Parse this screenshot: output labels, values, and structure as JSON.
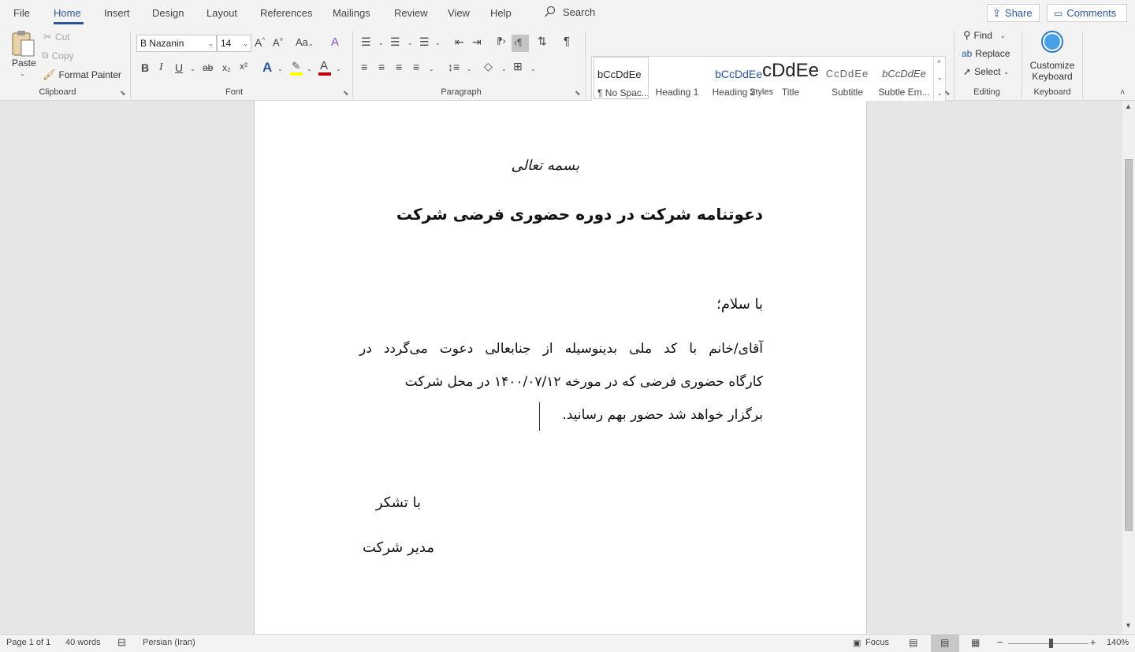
{
  "menu": {
    "tabs": [
      "File",
      "Home",
      "Insert",
      "Design",
      "Layout",
      "References",
      "Mailings",
      "Review",
      "View",
      "Help"
    ],
    "search": "Search",
    "share": "Share",
    "comments": "Comments"
  },
  "ribbon": {
    "clipboard": {
      "paste": "Paste",
      "cut": "Cut",
      "copy": "Copy",
      "format_painter": "Format Painter",
      "group": "Clipboard"
    },
    "font": {
      "name": "B Nazanin",
      "size": "14",
      "grow": "A^",
      "shrink": "A˅",
      "case": "Aa",
      "bold": "B",
      "italic": "I",
      "underline": "U",
      "strike": "ab",
      "sub": "x₂",
      "sup": "x²",
      "group": "Font"
    },
    "paragraph": {
      "group": "Paragraph"
    },
    "styles": {
      "group": "Styles",
      "items": [
        {
          "preview": "bCcDdEe",
          "name": "¶ No Spac..."
        },
        {
          "preview": "bCcDdEe",
          "name": "Heading 1"
        },
        {
          "preview": "bCcDdEe",
          "name": "Heading 2"
        },
        {
          "preview": "bCcDdEe",
          "name": "Title"
        },
        {
          "preview": "CcDdEe",
          "name": "Subtitle"
        },
        {
          "preview": "bCcDdEe",
          "name": "Subtle Em..."
        }
      ]
    },
    "editing": {
      "find": "Find",
      "replace": "Replace",
      "select": "Select",
      "group": "Editing"
    },
    "keyboard": {
      "customize": "Customize",
      "keyboard_word": "Keyboard",
      "group": "Keyboard"
    }
  },
  "document": {
    "header": "بسمه تعالی",
    "title": "دعوتنامه شرکت در دوره حضوری فرضی شرکت",
    "greeting": "با سلام؛",
    "body_line1": "آقای/خانم با کد ملی بدینوسیله از جنابعالی دعوت می‌گردد در",
    "body_line2": "کارگاه حضوری فرضی که در مورخه ۱۴۰۰/۰۷/۱۲ در محل شرکت",
    "body_line3": "برگزار خواهد شد حضور بهم رسانید.",
    "thanks": "با تشکر",
    "signature": "مدیر شرکت"
  },
  "status": {
    "page": "Page 1 of 1",
    "words": "40 words",
    "language": "Persian (Iran)",
    "focus": "Focus",
    "zoom": "140%"
  },
  "colors": {
    "accent": "#2b579a",
    "highlight": "#ffff00",
    "font_color": "#c00000"
  }
}
